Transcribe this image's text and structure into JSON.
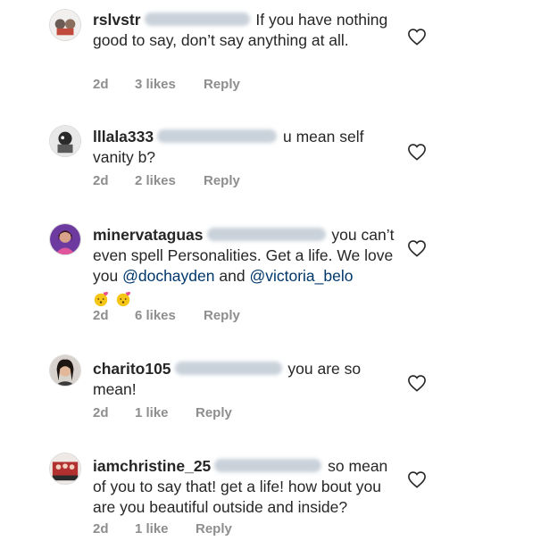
{
  "comments": [
    {
      "username": "rslvstr",
      "text": "If you have nothing good to say, don’t say anything at all.",
      "time": "2d",
      "likes": "3 likes",
      "reply": "Reply"
    },
    {
      "username": "lllala333",
      "text": "u mean self vanity b?",
      "time": "2d",
      "likes": "2 likes",
      "reply": "Reply"
    },
    {
      "username": "minervataguas",
      "text": "you can’t even spell Personalities. Get a life. We love you",
      "mention1": "@dochayden",
      "and": "and",
      "mention2": "@victoria_belo",
      "time": "2d",
      "likes": "6 likes",
      "reply": "Reply"
    },
    {
      "username": "charito105",
      "text": "you are so mean!",
      "time": "2d",
      "likes": "1 like",
      "reply": "Reply"
    },
    {
      "username": "iamchristine_25",
      "text": "so mean of you to say that! get a life! how bout you are you beautiful outside and inside?",
      "time": "2d",
      "likes": "1 like",
      "reply": "Reply"
    }
  ],
  "icons": {
    "heart": "heart-outline-icon",
    "emoji": "kissing-face-with-hearts-icon"
  },
  "colors": {
    "text": "#262626",
    "meta": "#8e8e8e",
    "link": "#00376b"
  }
}
